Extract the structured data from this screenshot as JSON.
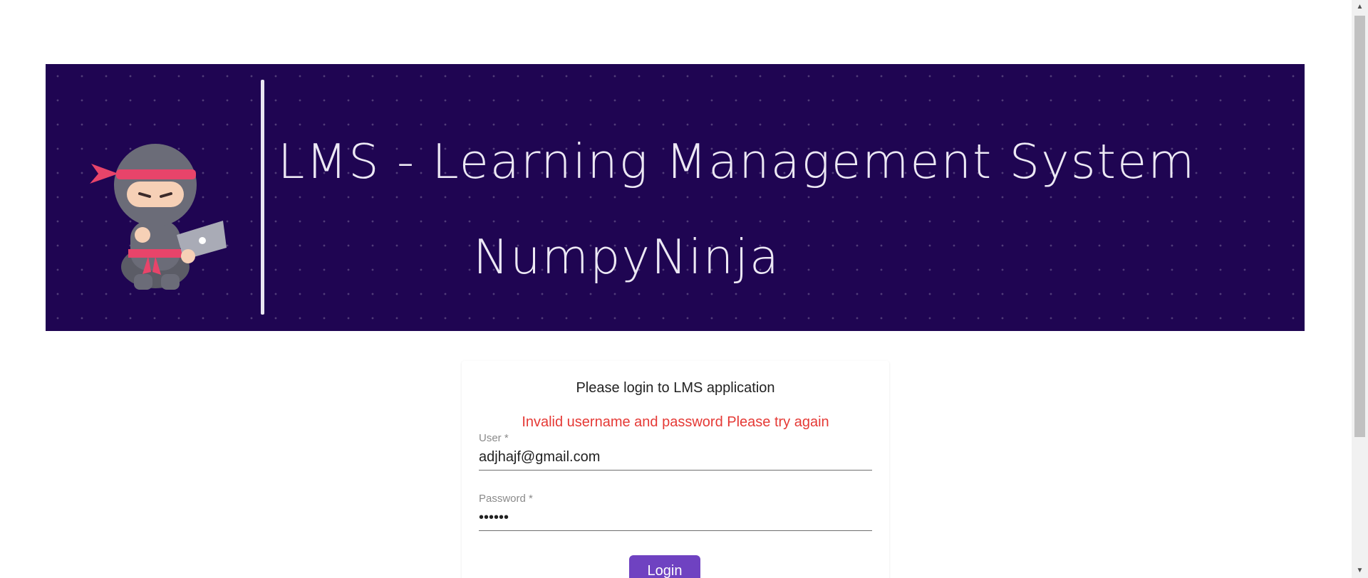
{
  "banner": {
    "title": "LMS - Learning Management System",
    "brand": "NumpyNinja",
    "background_color": "#1f0552",
    "mascot_icon": "ninja-with-laptop-icon"
  },
  "login": {
    "heading": "Please login to LMS application",
    "error": "Invalid username and password Please try again",
    "user_label": "User *",
    "user_value": "adjhajf@gmail.com",
    "password_label": "Password *",
    "password_value": "••••••",
    "button_label": "Login",
    "accent_color": "#6f42c1",
    "error_color": "#e53935"
  },
  "scrollbar": {
    "up_icon": "scroll-up-arrow-icon",
    "down_icon": "scroll-down-arrow-icon"
  }
}
